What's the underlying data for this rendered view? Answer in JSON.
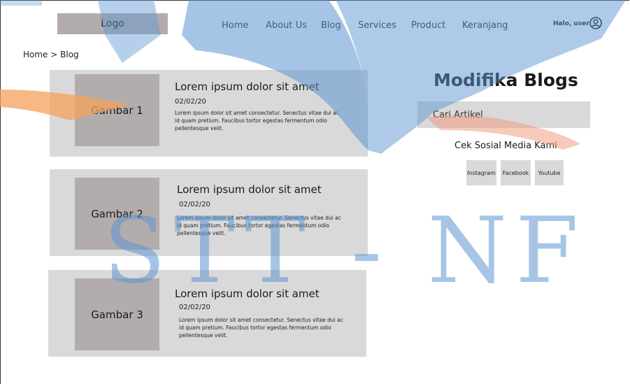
{
  "header": {
    "logo": "Logo",
    "nav": [
      "Home",
      "About Us",
      "Blog",
      "Services",
      "Product",
      "Keranjang"
    ],
    "user_greeting": "Halo, user",
    "user_icon": "user-circle-icon"
  },
  "breadcrumb": "Home > Blog",
  "posts": [
    {
      "image": "Gambar 1",
      "title": "Lorem ipsum dolor sit amet",
      "date": "02/02/20",
      "excerpt": "Lorem ipsum dolor sit amet consectetur. Senectus vitae dui ac id quam pretium. Faucibus tortor egestas fermentum odio pellentesque velit."
    },
    {
      "image": "Gambar 2",
      "title": "Lorem ipsum dolor sit amet",
      "date": "02/02/20",
      "excerpt": "Lorem ipsum dolor sit amet consectetur. Senectus vitae dui ac id quam pretium. Faucibus tortor egestas fermentum odio pellentesque velit."
    },
    {
      "image": "Gambar 3",
      "title": "Lorem ipsum dolor sit amet",
      "date": "02/02/20",
      "excerpt": "Lorem ipsum dolor sit amet consectetur. Senectus vitae dui ac id quam pretium. Faucibus tortor egestas fermentum odio pellentesque velit."
    }
  ],
  "sidebar": {
    "title": "Modifika Blogs",
    "search_placeholder": "Cari Artikel",
    "social_heading": "Cek Sosial Media Kami",
    "social": [
      "Instagram",
      "Facebook",
      "Youtube"
    ]
  },
  "watermark": "STT - NF",
  "colors": {
    "placeholder_box": "#b3acac",
    "card_bg": "#d9d9d9",
    "watermark_blue": "#5d96d2",
    "watermark_orange": "#f4a259"
  }
}
